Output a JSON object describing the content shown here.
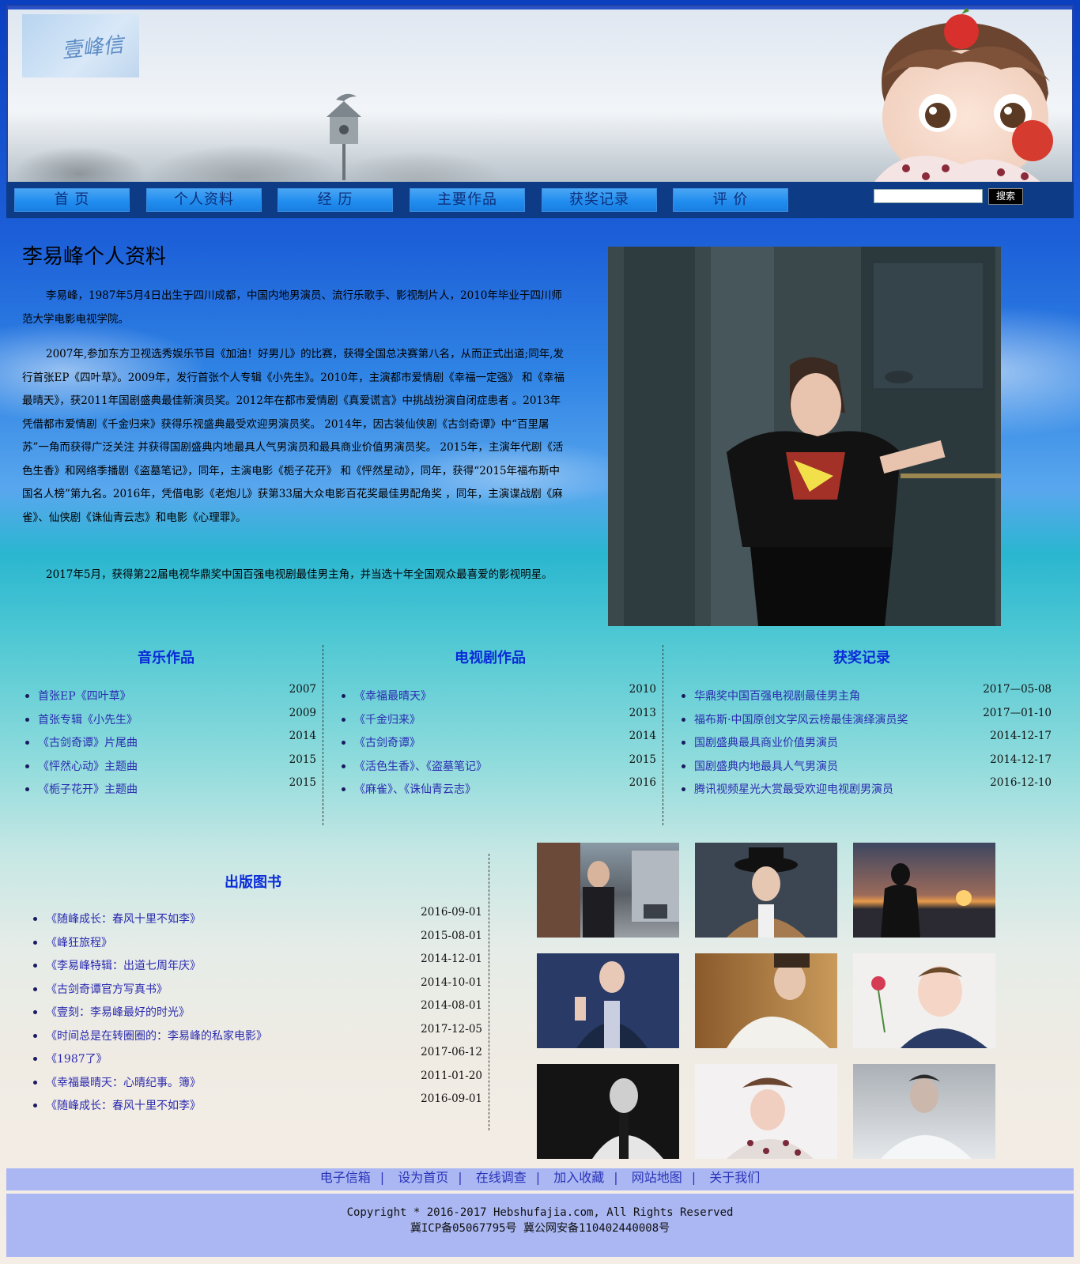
{
  "header": {
    "logo_text": "壹峰信"
  },
  "nav": {
    "items": [
      {
        "label": "首  页"
      },
      {
        "label": "个人资料"
      },
      {
        "label": "经  历"
      },
      {
        "label": "主要作品"
      },
      {
        "label": "获奖记录"
      },
      {
        "label": "评  价"
      }
    ],
    "search_value": "",
    "search_button": "搜索"
  },
  "profile": {
    "title": "李易峰个人资料",
    "paragraphs": [
      "李易峰，1987年5月4日出生于四川成都，中国内地男演员、流行乐歌手、影视制片人，2010年毕业于四川师范大学电影电视学院。",
      "2007年,参加东方卫视选秀娱乐节目《加油！好男儿》的比赛，获得全国总决赛第八名，从而正式出道;同年,发行首张EP《四叶草》。2009年，发行首张个人专辑《小先生》。2010年，主演都市爱情剧《幸福一定强》 和《幸福最晴天》，获2011年国剧盛典最佳新演员奖。2012年在都市爱情剧《真爱谎言》中挑战扮演自闭症患者 。2013年凭借都市爱情剧《千金归来》获得乐视盛典最受欢迎男演员奖。 2014年，因古装仙侠剧《古剑奇谭》中“百里屠苏”一角而获得广泛关注 并获得国剧盛典内地最具人气男演员和最具商业价值男演员奖。 2015年，主演年代剧《活色生香》和网络季播剧《盗墓笔记》，同年，主演电影《栀子花开》 和《怦然星动》，同年，获得“2015年福布斯中国名人榜”第九名。2016年，凭借电影《老炮儿》获第33届大众电影百花奖最佳男配角奖 ，同年，主演谍战剧《麻雀》、仙侠剧《诛仙青云志》和电影《心理罪》。",
      "2017年5月，获得第22届电视华鼎奖中国百强电视剧最佳男主角，并当选十年全国观众最喜爱的影视明星。"
    ]
  },
  "music": {
    "title": "音乐作品",
    "items": [
      {
        "name": "首张EP《四叶草》",
        "date": "2007"
      },
      {
        "name": "首张专辑《小先生》",
        "date": "2009"
      },
      {
        "name": "《古剑奇谭》片尾曲",
        "date": "2014"
      },
      {
        "name": "《怦然心动》主题曲",
        "date": "2015"
      },
      {
        "name": "《栀子花开》主题曲",
        "date": "2015"
      }
    ]
  },
  "tv": {
    "title": "电视剧作品",
    "items": [
      {
        "name": "《幸福最晴天》",
        "date": "2010"
      },
      {
        "name": "《千金归来》",
        "date": "2013"
      },
      {
        "name": "《古剑奇谭》",
        "date": "2014"
      },
      {
        "name": "《活色生香》、《盗墓笔记》",
        "date": "2015"
      },
      {
        "name": "《麻雀》、《诛仙青云志》",
        "date": "2016"
      }
    ]
  },
  "awards": {
    "title": "获奖记录",
    "items": [
      {
        "name": "华鼎奖中国百强电视剧最佳男主角",
        "date": "2017—05-08"
      },
      {
        "name": "福布斯·中国原创文学风云榜最佳演绎演员奖",
        "date": "2017—01-10"
      },
      {
        "name": "国剧盛典最具商业价值男演员",
        "date": "2014-12-17"
      },
      {
        "name": "国剧盛典内地最具人气男演员",
        "date": "2014-12-17"
      },
      {
        "name": "腾讯视频星光大赏最受欢迎电视剧男演员",
        "date": "2016-12-10"
      }
    ]
  },
  "books": {
    "title": "出版图书",
    "items": [
      {
        "name": "《随峰成长：春风十里不如李》",
        "date": "2016-09-01"
      },
      {
        "name": "《峰狂旅程》",
        "date": "2015-08-01"
      },
      {
        "name": "《李易峰特辑：出道七周年庆》",
        "date": "2014-12-01"
      },
      {
        "name": "《古剑奇谭官方写真书》",
        "date": "2014-10-01"
      },
      {
        "name": "《壹刻：李易峰最好的时光》",
        "date": "2014-08-01"
      },
      {
        "name": "《时间总是在转圈圈的：李易峰的私家电影》",
        "date": "2017-12-05"
      },
      {
        "name": "《1987了》",
        "date": "2017-06-12"
      },
      {
        "name": "《幸福最晴天：心晴纪事。簿》",
        "date": "2011-01-20"
      },
      {
        "name": "《随峰成长：春风十里不如李》",
        "date": "2016-09-01"
      }
    ]
  },
  "gallery": {
    "photos": [
      {
        "icon": "street-photo"
      },
      {
        "icon": "hat-portrait-photo"
      },
      {
        "icon": "sunset-silhouette-photo"
      },
      {
        "icon": "microphone-photo"
      },
      {
        "icon": "white-sweater-photo"
      },
      {
        "icon": "rose-selfie-photo"
      },
      {
        "icon": "monochrome-photo"
      },
      {
        "icon": "pillow-photo"
      },
      {
        "icon": "misty-portrait-photo"
      }
    ]
  },
  "footer": {
    "links": [
      "电子信箱",
      "设为首页",
      "在线调查",
      "加入收藏",
      "网站地图",
      "关于我们"
    ],
    "copyright": "Copyright  *  2016-2017 Hebshufajia.com, All Rights Reserved",
    "icp": "冀ICP备05067795号 冀公网安备110402440008号"
  },
  "colors": {
    "nav_bar": "#0e3b86",
    "nav_button": "#1f8cef",
    "section_title": "#0a2cd8",
    "link": "#2b2bb0",
    "footer_bg": "#aab7f2"
  }
}
